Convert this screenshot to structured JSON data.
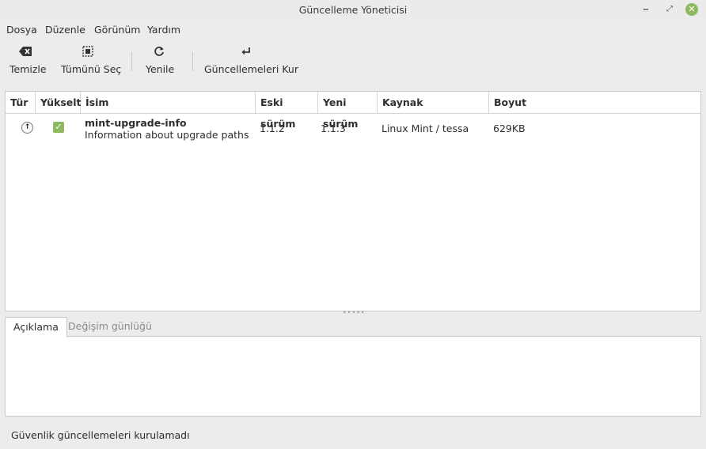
{
  "window": {
    "title": "Güncelleme Yöneticisi",
    "controls": [
      "minimize",
      "maximize",
      "close"
    ]
  },
  "menu": {
    "items": [
      "Dosya",
      "Düzenle",
      "Görünüm",
      "Yardım"
    ]
  },
  "toolbar": {
    "clear": {
      "label": "Temizle",
      "icon": "backspace-icon"
    },
    "select_all": {
      "label": "Tümünü Seç",
      "icon": "select-all-icon"
    },
    "refresh": {
      "label": "Yenile",
      "icon": "refresh-icon"
    },
    "install": {
      "label": "Güncellemeleri Kur",
      "icon": "return-icon"
    }
  },
  "table": {
    "columns": [
      "Tür",
      "Yükselt",
      "İsim",
      "Eski sürüm",
      "Yeni sürüm",
      "Kaynak",
      "Boyut"
    ],
    "rows": [
      {
        "type_icon": "upgrade-arrow-icon",
        "upgrade_checked": true,
        "name": "mint-upgrade-info",
        "description": "Information about upgrade paths",
        "old_version": "1.1.2",
        "new_version": "1.1.3",
        "source": "Linux Mint / tessa",
        "size": "629KB"
      }
    ]
  },
  "tabs": {
    "description": "Açıklama",
    "changelog": "Değişim günlüğü",
    "active": "description"
  },
  "status": {
    "text": "Güvenlik güncellemeleri kurulamadı"
  },
  "colors": {
    "accent": "#8fb960",
    "background": "#ececec"
  }
}
